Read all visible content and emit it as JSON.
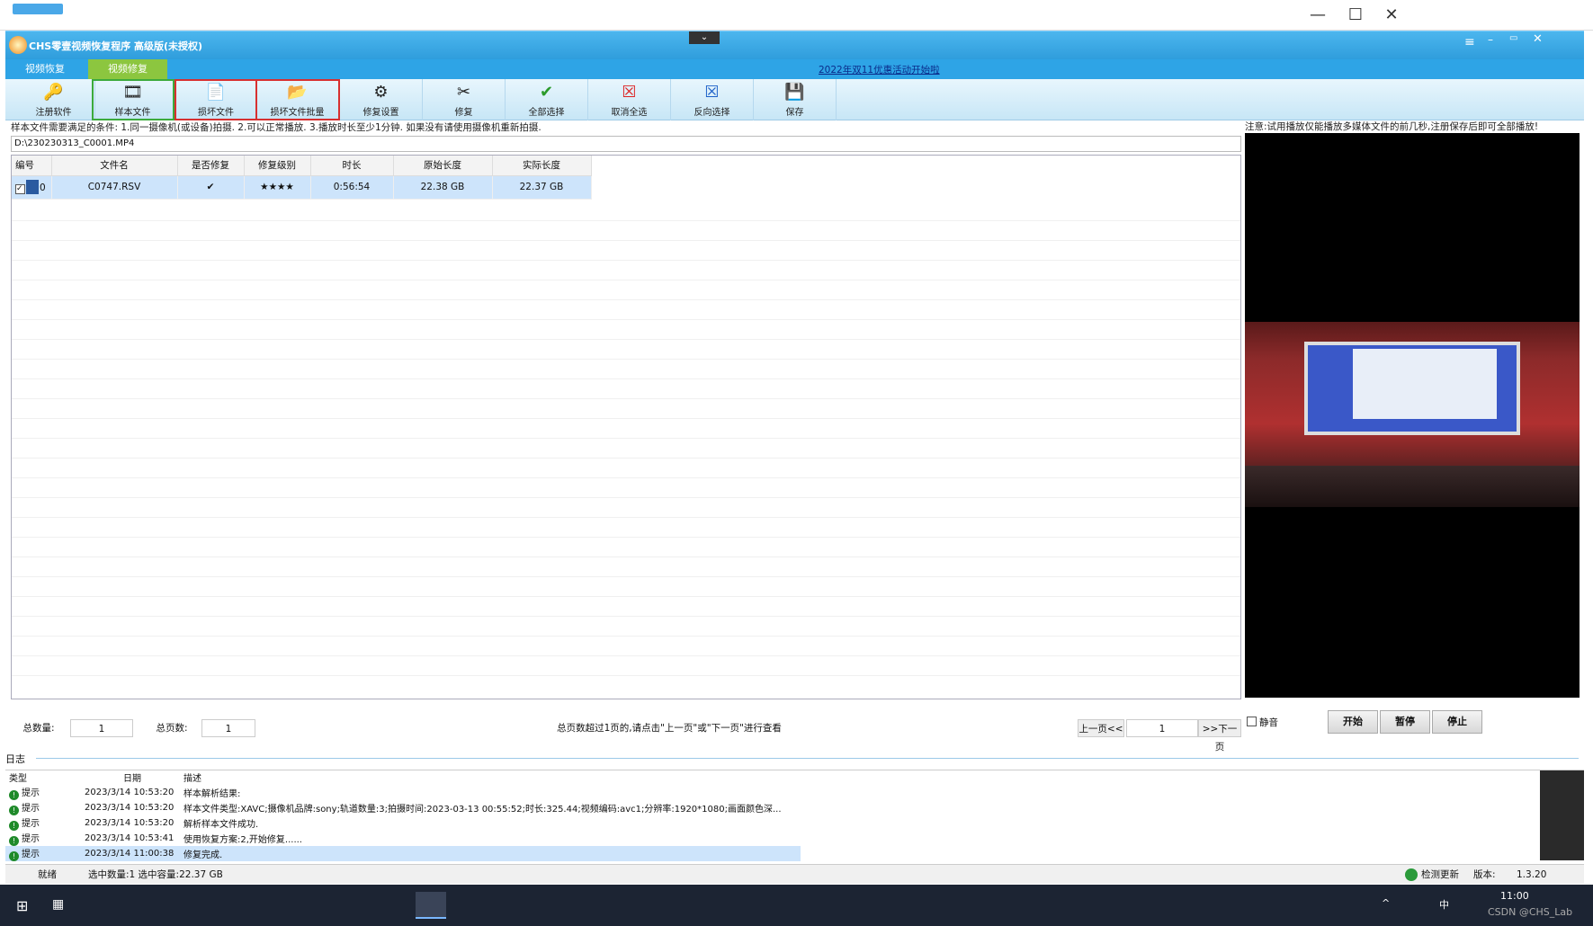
{
  "window": {
    "outer_title": "",
    "minimize": "—",
    "maximize": "☐",
    "close": "✕"
  },
  "app": {
    "title": "CHS零壹视频恢复程序 高级版(未授权)",
    "promo": "2022年双11优惠活动开始啦",
    "collapse_icon": "chevron-down-icon"
  },
  "tabs": [
    {
      "label": "视频恢复"
    },
    {
      "label": "视频修复"
    }
  ],
  "toolbar": [
    {
      "label": "注册软件",
      "icon": "key-icon"
    },
    {
      "label": "样本文件",
      "icon": "film-icon"
    },
    {
      "label": "损坏文件",
      "icon": "file-icon"
    },
    {
      "label": "损坏文件批量",
      "icon": "files-icon"
    },
    {
      "label": "修复设置",
      "icon": "settings-icon"
    },
    {
      "label": "修复",
      "icon": "tools-icon"
    },
    {
      "label": "全部选择",
      "icon": "check-icon"
    },
    {
      "label": "取消全选",
      "icon": "x-box-icon"
    },
    {
      "label": "反向选择",
      "icon": "invert-icon"
    },
    {
      "label": "保存",
      "icon": "disk-icon"
    }
  ],
  "condition_text": "样本文件需要满足的条件: 1.同一摄像机(或设备)拍摄. 2.可以正常播放. 3.播放时长至少1分钟.  如果没有请使用摄像机重新拍摄.",
  "sample_path": "D:\\230230313_C0001.MP4",
  "table": {
    "columns": [
      "编号",
      "文件名",
      "是否修复",
      "修复级别",
      "时长",
      "原始长度",
      "实际长度"
    ],
    "rows": [
      {
        "id": "0",
        "name": "C0747.RSV",
        "repaired": "✔",
        "level": "★★★★",
        "duration": "0:56:54",
        "orig_len": "22.38 GB",
        "real_len": "22.37 GB"
      }
    ]
  },
  "pager": {
    "total_label": "总数量:",
    "total": "1",
    "pages_label": "总页数:",
    "pages": "1",
    "hint": "总页数超过1页的,请点击\"上一页\"或\"下一页\"进行查看",
    "prev": "上一页<<",
    "page": "1",
    "next": ">>下一页"
  },
  "preview": {
    "note": "注意:试用播放仅能播放多媒体文件的前几秒,注册保存后即可全部播放!",
    "mute": "静音",
    "start": "开始",
    "pause": "暂停",
    "stop": "停止"
  },
  "log": {
    "label": "日志",
    "columns": [
      "类型",
      "日期",
      "描述"
    ],
    "rows": [
      {
        "type": "提示",
        "date": "2023/3/14 10:53:20",
        "desc": "样本解析结果:"
      },
      {
        "type": "提示",
        "date": "2023/3/14 10:53:20",
        "desc": "样本文件类型:XAVC;摄像机品牌:sony;轨道数量:3;拍摄时间:2023-03-13 00:55:52;时长:325.44;视频编码:avc1;分辨率:1920*1080;画面颜色深..."
      },
      {
        "type": "提示",
        "date": "2023/3/14 10:53:20",
        "desc": "解析样本文件成功."
      },
      {
        "type": "提示",
        "date": "2023/3/14 10:53:41",
        "desc": "使用恢复方案:2,开始修复......"
      },
      {
        "type": "提示",
        "date": "2023/3/14 11:00:38",
        "desc": "修复完成."
      }
    ]
  },
  "status": {
    "ready": "就绪",
    "selection": "选中数量:1 选中容量:22.37 GB",
    "update": "检测更新",
    "version_label": "版本:",
    "version": "1.3.20"
  },
  "taskbar": {
    "time": "11:00",
    "ime": "中",
    "watermark": "CSDN @CHS_Lab"
  },
  "colors": {
    "accent": "#2ea4e6",
    "tab_active": "#8cc63f"
  }
}
